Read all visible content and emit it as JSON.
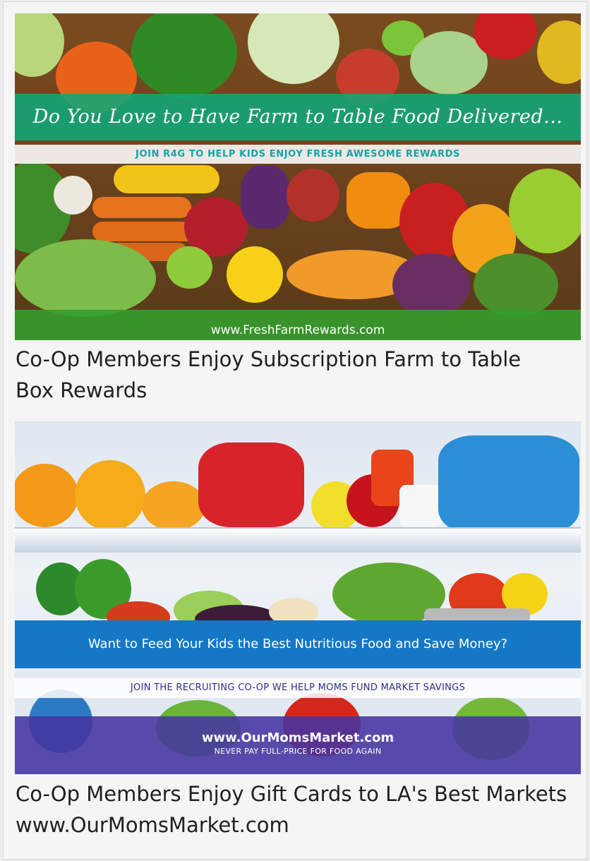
{
  "cards": [
    {
      "banner": {
        "title": "Do You Love to Have Farm to Table Food Delivered...",
        "subtitle": "JOIN R4G TO HELP KIDS ENJOY FRESH AWESOME REWARDS",
        "url": "www.FreshFarmRewards.com"
      },
      "caption_line1": "Co-Op Members Enjoy Subscription Farm to Table",
      "caption_line2": "Box Rewards"
    },
    {
      "banner": {
        "title": "Want to Feed Your Kids the Best Nutritious Food and Save Money?",
        "subtitle": "JOIN THE RECRUITING CO-OP WE HELP MOMS FUND MARKET SAVINGS",
        "url": "www.OurMomsMarket.com",
        "tagline": "NEVER PAY FULL-PRICE FOR FOOD AGAIN"
      },
      "caption_line1": "Co-Op Members Enjoy Gift Cards to LA's Best Markets",
      "caption_line2": "www.OurMomsMarket.com"
    }
  ],
  "colors": {
    "green_band": "#10a878",
    "url_band_green": "#349d2c",
    "blue_band": "#1478c6",
    "purple_band": "#4634a0",
    "teal_text": "#13a3a8"
  }
}
